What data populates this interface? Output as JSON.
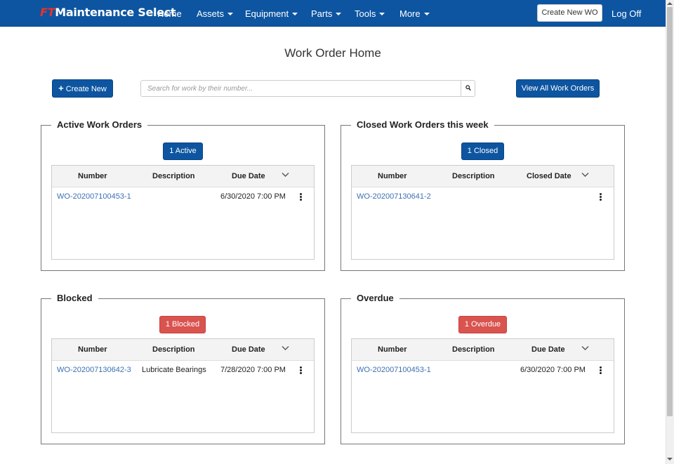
{
  "app": {
    "brand_prefix": "FT",
    "brand_name": "Maintenance Select"
  },
  "nav": {
    "items": [
      {
        "label": "Home",
        "dropdown": false
      },
      {
        "label": "Assets",
        "dropdown": true
      },
      {
        "label": "Equipment",
        "dropdown": true
      },
      {
        "label": "Parts",
        "dropdown": true
      },
      {
        "label": "Tools",
        "dropdown": true
      },
      {
        "label": "More",
        "dropdown": true
      }
    ],
    "create_new_wo": "Create New WO",
    "log_off": "Log Off"
  },
  "page": {
    "title": "Work Order Home",
    "create_new_label": "Create New",
    "search_placeholder": "Search for work by their number...",
    "view_all_label": "View All Work Orders"
  },
  "panels": {
    "active": {
      "title": "Active Work Orders",
      "count_label": "1 Active",
      "columns": [
        "Number",
        "Description",
        "Due Date"
      ],
      "rows": [
        {
          "number": "WO-202007100453-1",
          "description": "",
          "date": "6/30/2020 7:00 PM"
        }
      ]
    },
    "closed": {
      "title": "Closed Work Orders this week",
      "count_label": "1 Closed",
      "columns": [
        "Number",
        "Description",
        "Closed Date"
      ],
      "rows": [
        {
          "number": "WO-202007130641-2",
          "description": "",
          "date": ""
        }
      ]
    },
    "blocked": {
      "title": "Blocked",
      "count_label": "1 Blocked",
      "columns": [
        "Number",
        "Description",
        "Due Date"
      ],
      "rows": [
        {
          "number": "WO-202007130642-3",
          "description": "Lubricate Bearings",
          "date": "7/28/2020 7:00 PM"
        }
      ]
    },
    "overdue": {
      "title": "Overdue",
      "count_label": "1 Overdue",
      "columns": [
        "Number",
        "Description",
        "Due Date"
      ],
      "rows": [
        {
          "number": "WO-202007100453-1",
          "description": "",
          "date": "6/30/2020 7:00 PM"
        }
      ]
    }
  },
  "colors": {
    "nav_bg": "#0d55a0",
    "primary": "#0d55a0",
    "danger": "#d9534f",
    "link": "#3d70b2"
  }
}
